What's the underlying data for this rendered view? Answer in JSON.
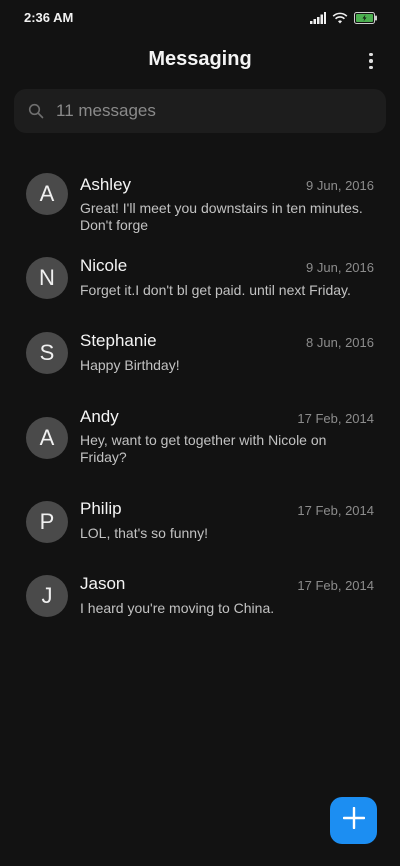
{
  "status_bar": {
    "time": "2:36 AM",
    "icons": [
      "signal-icon",
      "wifi-icon",
      "battery-charging-icon"
    ],
    "battery_color": "#4caf50"
  },
  "header": {
    "title": "Messaging",
    "menu_icon": "more-vertical-icon"
  },
  "search": {
    "icon": "search-icon",
    "label": "11 messages"
  },
  "conversations": [
    {
      "initial": "A",
      "name": "Ashley",
      "date": "9 Jun, 2016",
      "preview": "Great! I'll meet you downstairs in ten minutes. Don't forge"
    },
    {
      "initial": "N",
      "name": "Nicole",
      "date": "9 Jun, 2016",
      "preview": "Forget it.I don't bl get paid. until next Friday."
    },
    {
      "initial": "S",
      "name": "Stephanie",
      "date": "8 Jun, 2016",
      "preview": "Happy Birthday!"
    },
    {
      "initial": "A",
      "name": "Andy",
      "date": "17 Feb, 2014",
      "preview": "Hey, want to get together with Nicole on Friday?"
    },
    {
      "initial": "P",
      "name": "Philip",
      "date": "17 Feb, 2014",
      "preview": "LOL, that's so funny!"
    },
    {
      "initial": "J",
      "name": "Jason",
      "date": "17 Feb, 2014",
      "preview": "I heard you're moving to China."
    }
  ],
  "fab": {
    "icon": "plus-icon",
    "color": "#1c8ef2"
  },
  "colors": {
    "background": "#121212",
    "avatar": "#4a4a4a",
    "search_bar": "#1d1d1d"
  }
}
